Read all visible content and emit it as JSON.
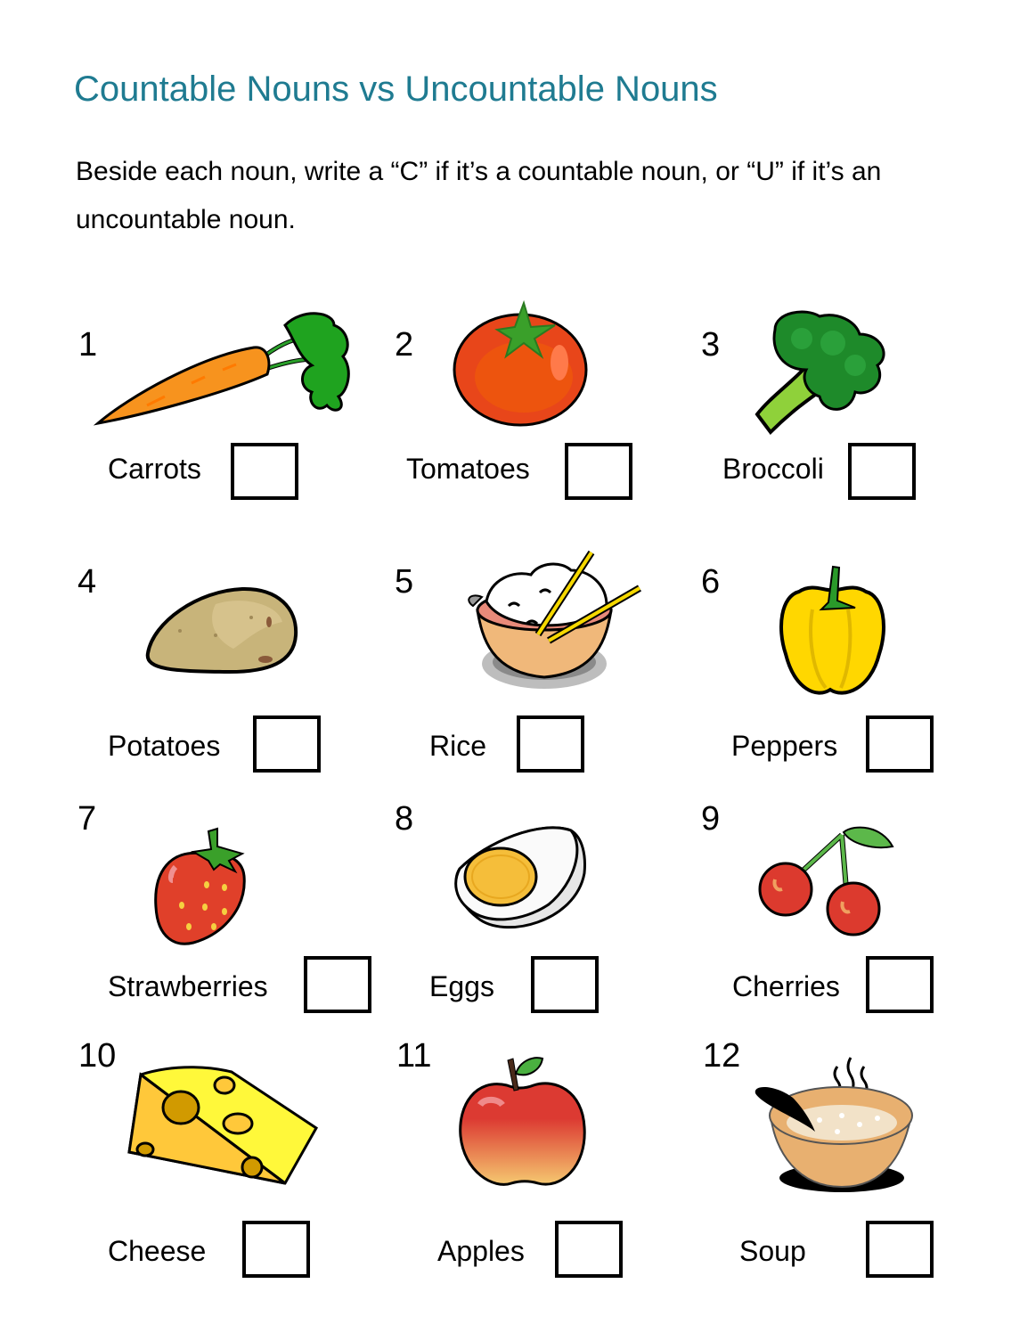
{
  "title": "Countable Nouns vs Uncountable Nouns",
  "instructions": "Beside each noun, write a “C” if it’s a countable noun, or “U” if it’s an uncountable noun.",
  "colors": {
    "title": "#1f7b91"
  },
  "items": [
    {
      "number": "1",
      "word": "Carrots",
      "icon": "carrot-icon",
      "answer": ""
    },
    {
      "number": "2",
      "word": "Tomatoes",
      "icon": "tomato-icon",
      "answer": ""
    },
    {
      "number": "3",
      "word": "Broccoli",
      "icon": "broccoli-icon",
      "answer": ""
    },
    {
      "number": "4",
      "word": "Potatoes",
      "icon": "potato-icon",
      "answer": ""
    },
    {
      "number": "5",
      "word": "Rice",
      "icon": "rice-bowl-icon",
      "answer": ""
    },
    {
      "number": "6",
      "word": "Peppers",
      "icon": "pepper-icon",
      "answer": ""
    },
    {
      "number": "7",
      "word": "Strawberries",
      "icon": "strawberry-icon",
      "answer": ""
    },
    {
      "number": "8",
      "word": "Eggs",
      "icon": "egg-icon",
      "answer": ""
    },
    {
      "number": "9",
      "word": "Cherries",
      "icon": "cherries-icon",
      "answer": ""
    },
    {
      "number": "10",
      "word": "Cheese",
      "icon": "cheese-icon",
      "answer": ""
    },
    {
      "number": "11",
      "word": "Apples",
      "icon": "apple-icon",
      "answer": ""
    },
    {
      "number": "12",
      "word": "Soup",
      "icon": "soup-bowl-icon",
      "answer": ""
    }
  ]
}
